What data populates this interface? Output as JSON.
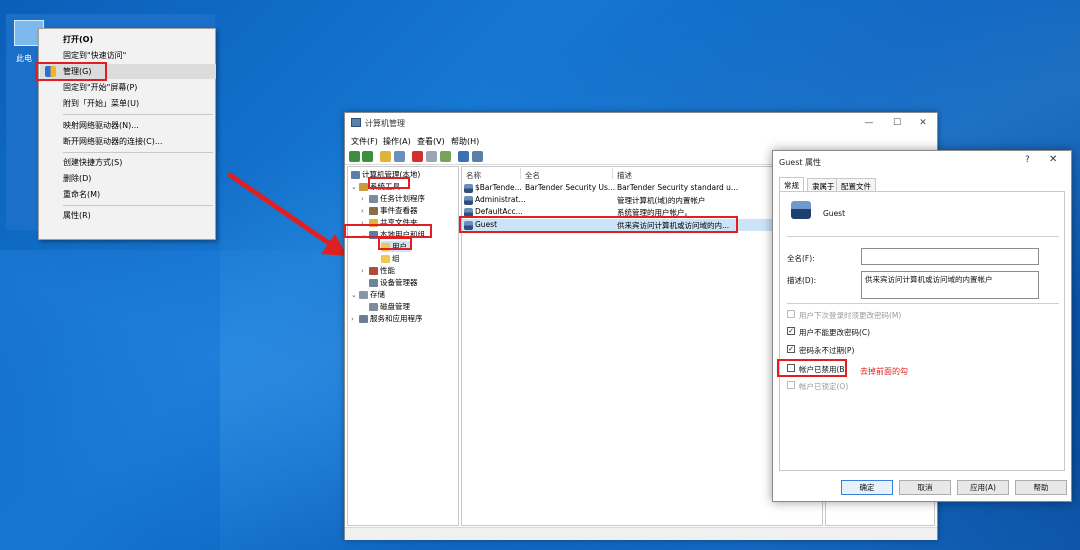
{
  "desktop": {
    "icon_label": "此电"
  },
  "context_menu": {
    "items": [
      {
        "label": "打开(O)",
        "bold": true
      },
      {
        "label": "固定到\"快速访问\""
      },
      {
        "label": "管理(G)",
        "highlighted": true
      },
      {
        "label": "固定到\"开始\"屏幕(P)"
      },
      {
        "label": "附到「开始」菜单(U)"
      },
      {
        "label": "映射网络驱动器(N)..."
      },
      {
        "label": "断开网络驱动器的连接(C)..."
      },
      {
        "label": "创建快捷方式(S)"
      },
      {
        "label": "删除(D)"
      },
      {
        "label": "重命名(M)"
      },
      {
        "label": "属性(R)"
      }
    ]
  },
  "computer_management": {
    "title": "计算机管理",
    "window_buttons": {
      "minimize": "—",
      "maximize": "☐",
      "close": "✕"
    },
    "menu": [
      "文件(F)",
      "操作(A)",
      "查看(V)",
      "帮助(H)"
    ],
    "tree": {
      "root": "计算机管理(本地)",
      "system_tools": "系统工具",
      "task_scheduler": "任务计划程序",
      "event_viewer": "事件查看器",
      "shared_folders": "共享文件夹",
      "local_users_groups": "本地用户和组",
      "users": "用户",
      "groups": "组",
      "performance": "性能",
      "device_manager": "设备管理器",
      "storage": "存储",
      "disk_management": "磁盘管理",
      "services_apps": "服务和应用程序"
    },
    "list_headers": {
      "name": "名称",
      "fullname": "全名",
      "description": "描述"
    },
    "users": [
      {
        "name": "$BarTende...",
        "fullname": "BarTender Security Us...",
        "description": "BarTender Security standard u..."
      },
      {
        "name": "Administrat...",
        "fullname": "",
        "description": "管理计算机(域)的内置帐户"
      },
      {
        "name": "DefaultAcc...",
        "fullname": "",
        "description": "系统管理的用户帐户。"
      },
      {
        "name": "Guest",
        "fullname": "",
        "description": "供来宾访问计算机或访问域的内...",
        "selected": true
      }
    ]
  },
  "guest_dialog": {
    "title": "Guest 属性",
    "help": "?",
    "close": "✕",
    "tabs": [
      "常规",
      "隶属于",
      "配置文件"
    ],
    "username": "Guest",
    "fullname_label": "全名(F):",
    "fullname_value": "",
    "description_label": "描述(D):",
    "description_value": "供来宾访问计算机或访问域的内置帐户",
    "checkboxes": [
      {
        "label": "用户下次登录时须更改密码(M)",
        "checked": false,
        "disabled": true
      },
      {
        "label": "用户不能更改密码(C)",
        "checked": true,
        "disabled": false
      },
      {
        "label": "密码永不过期(P)",
        "checked": true,
        "disabled": false
      },
      {
        "label": "帐户已禁用(B)",
        "checked": false,
        "disabled": false
      },
      {
        "label": "帐户已锁定(O)",
        "checked": false,
        "disabled": true
      }
    ],
    "buttons": {
      "ok": "确定",
      "cancel": "取消",
      "apply": "应用(A)",
      "help": "帮助"
    }
  },
  "annotation": "去掉前面的勾",
  "colors": {
    "annotation_red": "#e02020",
    "selection_blue": "#cce4f7",
    "desktop_blue": "#1677d2"
  }
}
